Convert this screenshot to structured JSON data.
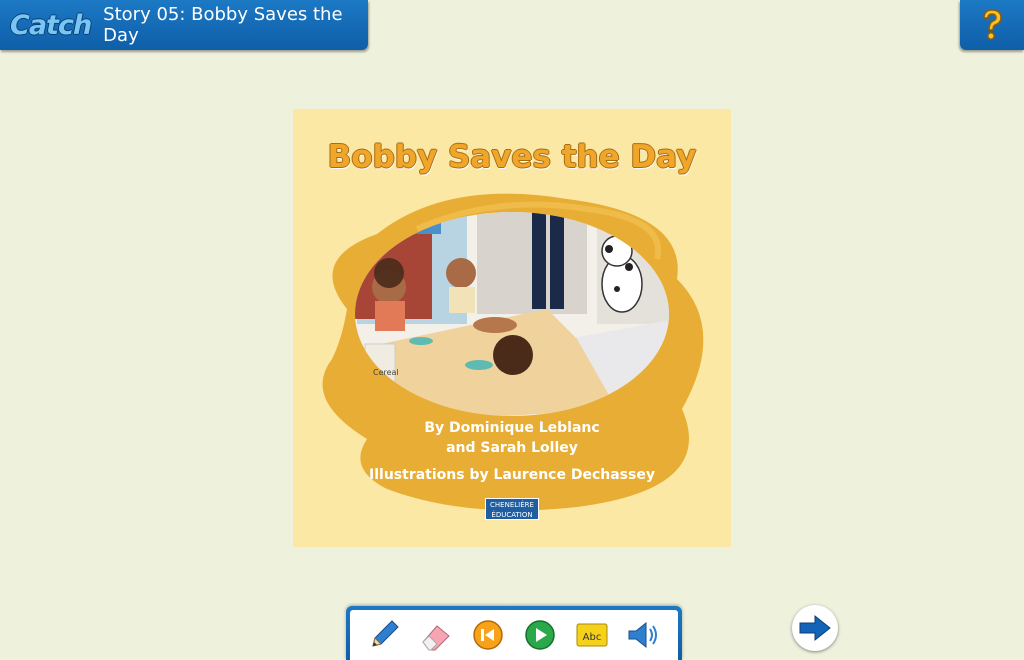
{
  "header": {
    "logo_text": "Catch",
    "story_title": "Story 05: Bobby Saves the Day"
  },
  "help": {
    "icon": "question-mark-icon"
  },
  "cover": {
    "title": "Bobby Saves the Day",
    "author_line1": "By Dominique Leblanc",
    "author_line2": "and Sarah Lolley",
    "illustrator": "Illustrations by Laurence Dechassey",
    "publisher_line1": "CHENELIÈRE",
    "publisher_line2": "ÉDUCATION",
    "illustration_text": "Cereal"
  },
  "toolbar": {
    "tools": [
      {
        "name": "pencil-icon"
      },
      {
        "name": "eraser-icon"
      },
      {
        "name": "rewind-icon"
      },
      {
        "name": "play-icon"
      },
      {
        "name": "abc-icon",
        "label": "Abc"
      },
      {
        "name": "speaker-icon"
      }
    ]
  },
  "colors": {
    "header_blue": "#1569b6",
    "page_bg": "#eef1dc",
    "cover_bg": "#fbe8a4",
    "blob_orange": "#e8ad35",
    "title_orange": "#f0a62a"
  }
}
